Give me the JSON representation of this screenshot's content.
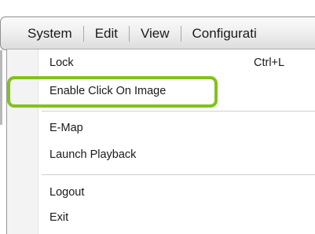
{
  "menubar": {
    "items": [
      {
        "label": "System"
      },
      {
        "label": "Edit"
      },
      {
        "label": "View"
      },
      {
        "label": "Configurati"
      }
    ]
  },
  "dropdown": {
    "items": [
      {
        "label": "Lock",
        "shortcut": "Ctrl+L"
      },
      {
        "label": "Enable Click On Image"
      },
      {
        "label": "E-Map"
      },
      {
        "label": "Launch Playback"
      },
      {
        "label": "Logout"
      },
      {
        "label": "Exit"
      }
    ]
  },
  "highlight_color": "#82c21d"
}
